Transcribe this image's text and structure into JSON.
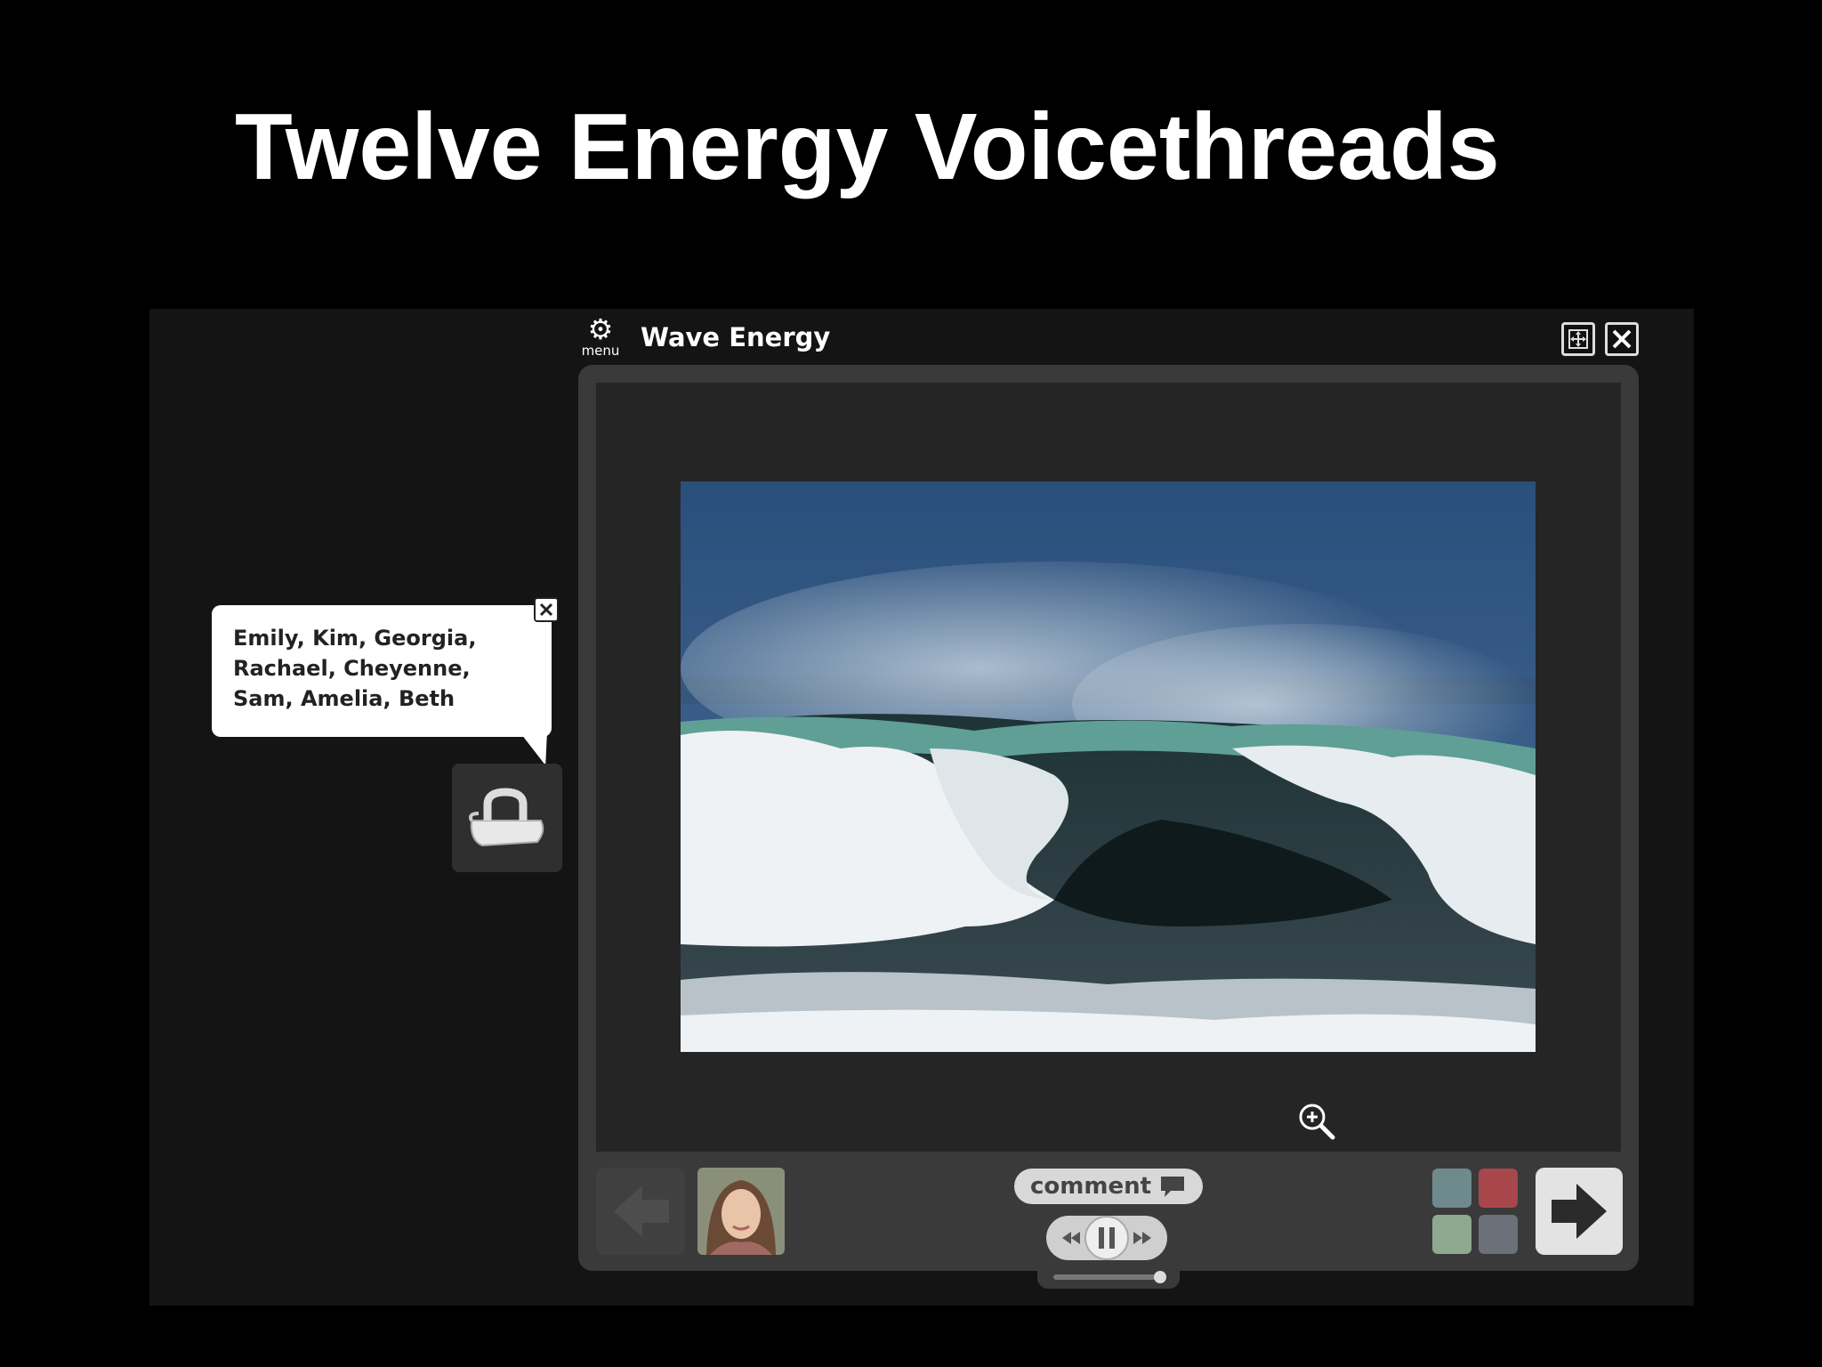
{
  "slide": {
    "title": "Twelve Energy Voicethreads"
  },
  "voicethread": {
    "menu_label": "menu",
    "title": "Wave Energy",
    "comment_label": "comment"
  },
  "speech_bubble": {
    "text": "Emily, Kim, Georgia, Rachael, Cheyenne, Sam, Amelia, Beth"
  },
  "icons": {
    "menu": "gear-icon",
    "expand": "expand-icon",
    "close": "close-icon",
    "zoom": "zoom-in-icon",
    "commenter": "iron-icon",
    "prev": "arrow-left-icon",
    "next": "arrow-right-icon",
    "comment": "speech-bubble-icon",
    "rewind": "rewind-icon",
    "pause": "pause-icon",
    "forward": "fast-forward-icon"
  },
  "colors": {
    "background": "#000000",
    "frame": "#141414",
    "panel": "#3a3a3a",
    "stage": "#252525",
    "text": "#ffffff"
  }
}
